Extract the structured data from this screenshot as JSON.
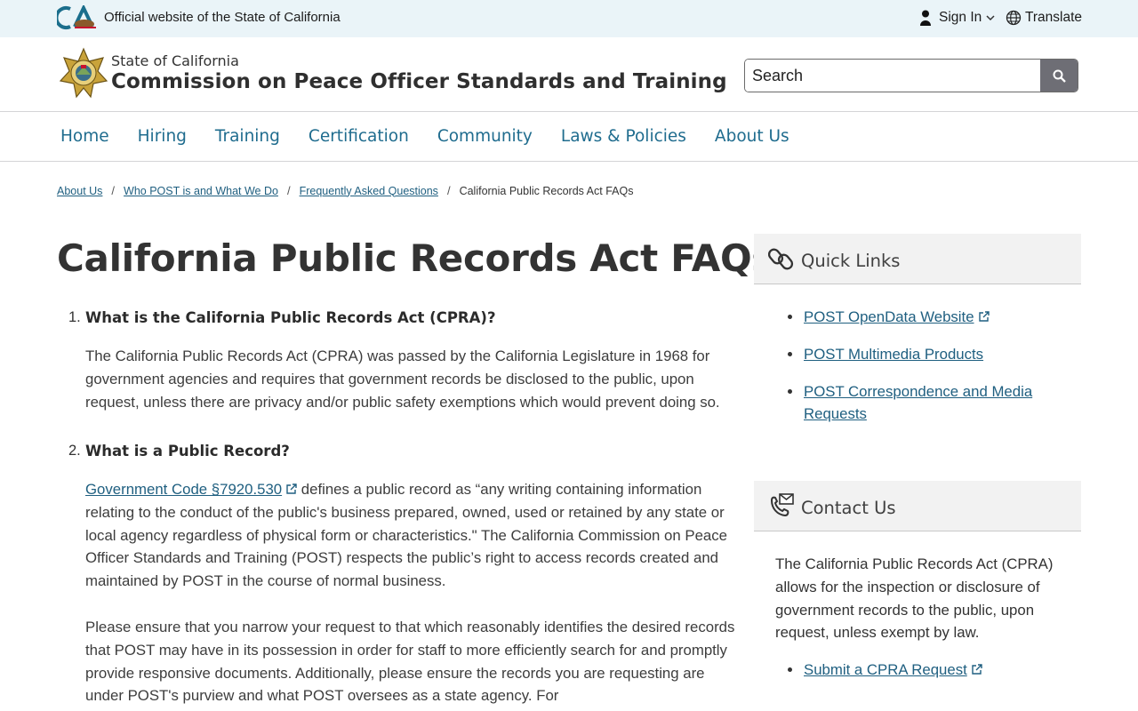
{
  "utility": {
    "official_text": "Official website of the State of California",
    "signin_label": "Sign In",
    "translate_label": "Translate"
  },
  "branding": {
    "state_line": "State of California",
    "org_name": "Commission on Peace Officer Standards and Training",
    "search_placeholder": "Search"
  },
  "nav": [
    "Home",
    "Hiring",
    "Training",
    "Certification",
    "Community",
    "Laws & Policies",
    "About Us"
  ],
  "breadcrumb": {
    "items": [
      "About Us",
      "Who POST is and What We Do",
      "Frequently Asked Questions"
    ],
    "current": "California Public Records Act FAQs",
    "separator": "/"
  },
  "page": {
    "title": "California Public Records Act FAQs",
    "faq": [
      {
        "num": "1.",
        "question": "What is the California Public Records Act (CPRA)?",
        "answer": "The California Public Records Act (CPRA) was passed by the California Legislature in 1968 for government agencies and requires that government records be disclosed to the public, upon request, unless there are privacy and/or public safety exemptions which would prevent doing so."
      },
      {
        "num": "2.",
        "question": "What is a Public Record?",
        "link_text": "Government Code §7920.530",
        "answer_after_link": "defines a public record as “any writing containing information relating to the conduct of the public's business prepared, owned, used or retained by any state or local agency regardless of physical form or characteristics.\" The California Commission on Peace Officer Standards and Training (POST) respects the public’s right to access records created and maintained by POST in the course of normal business.",
        "answer_para2": "Please ensure that you narrow your request to that which reasonably identifies the desired records that POST may have in its possession in order for staff to more efficiently search for and promptly provide responsive documents. Additionally, please ensure the records you are requesting are under POST's purview and what POST oversees as a state agency. For"
      }
    ]
  },
  "sidebar": {
    "quick_links": {
      "title": "Quick Links",
      "links": [
        "POST OpenData Website",
        "POST Multimedia Products",
        "POST Correspondence and Media Requests"
      ]
    },
    "contact": {
      "title": "Contact Us",
      "text": "The California Public Records Act (CPRA) allows for the inspection or disclosure of government records to the public, upon request, unless exempt by law.",
      "link": "Submit a CPRA Request"
    }
  },
  "colors": {
    "link": "#1f5f80",
    "nav": "#1f6c8e",
    "utility_bg": "#eaf4f8",
    "search_button": "#6e6e75",
    "panel_bg": "#f2f2f2",
    "ca_logo_blue": "#1b6e8c",
    "ca_logo_red": "#c8102e"
  }
}
